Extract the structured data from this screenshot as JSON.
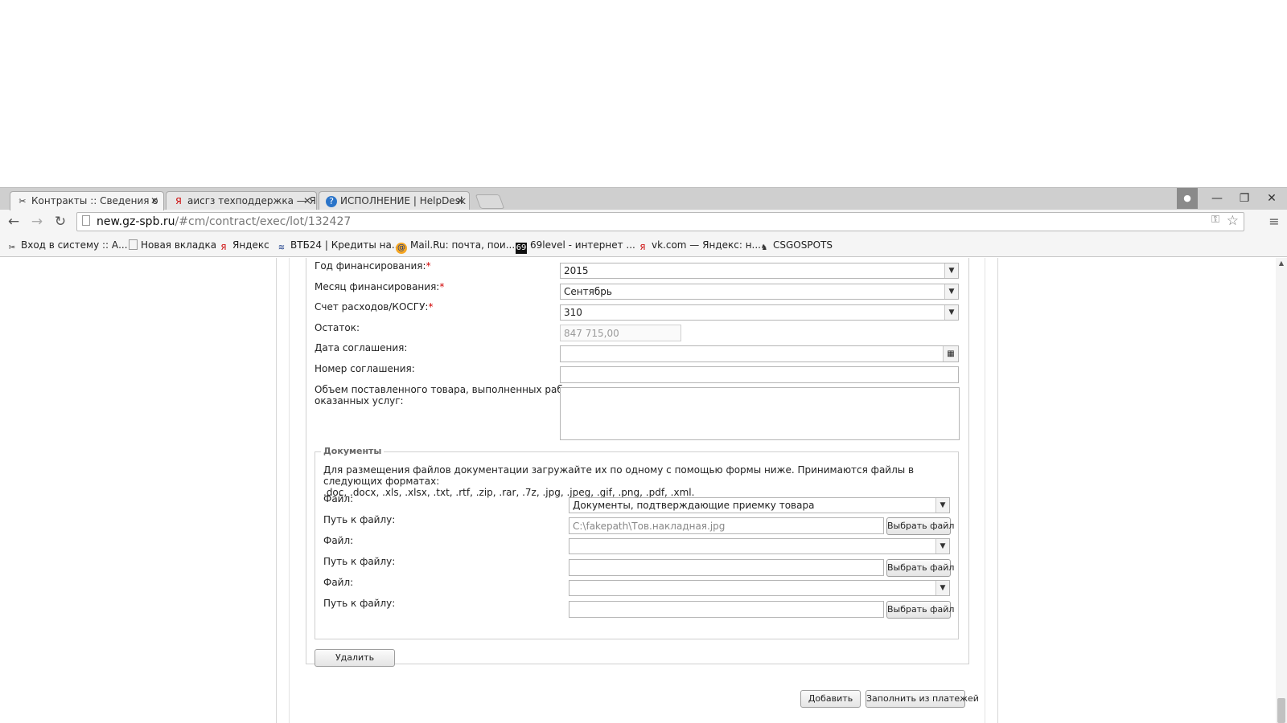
{
  "browser": {
    "tabs": [
      {
        "title": "Контракты :: Сведения о",
        "icon": "contract-icon",
        "close": "✕"
      },
      {
        "title": "аисгз техподдержка — Я",
        "icon": "yandex-icon",
        "close": "✕"
      },
      {
        "title": "ИСПОЛНЕНИЕ | HelpDesk",
        "icon": "helpdesk-icon",
        "close": "✕"
      }
    ],
    "window_controls": {
      "minimize": "—",
      "restore": "❐",
      "close": "✕"
    },
    "url_host": "new.gz-spb.ru",
    "url_path": "/#cm/contract/exec/lot/132427",
    "bookmarks": [
      {
        "label": "Вход в систему :: А...",
        "icon": "contract-icon"
      },
      {
        "label": "Новая вкладка",
        "icon": "page-icon"
      },
      {
        "label": "Яндекс",
        "icon": "yandex-icon"
      },
      {
        "label": "ВТБ24 | Кредиты на...",
        "icon": "vtb-icon"
      },
      {
        "label": "Mail.Ru: почта, пои...",
        "icon": "mailru-icon"
      },
      {
        "label": "69level - интернет ...",
        "icon": "69level-icon"
      },
      {
        "label": "vk.com — Яндекс: н...",
        "icon": "yandex-icon"
      },
      {
        "label": "CSGOSPOTS",
        "icon": "csgo-icon"
      }
    ]
  },
  "form": {
    "year_label": "Год финансирования:",
    "year_value": "2015",
    "month_label": "Месяц финансирования:",
    "month_value": "Сентябрь",
    "account_label": "Счет расходов/КОСГУ:",
    "account_value": "310",
    "balance_label": "Остаток:",
    "balance_value": "847 715,00",
    "agreement_date_label": "Дата соглашения:",
    "agreement_date_value": "",
    "agreement_number_label": "Номер соглашения:",
    "agreement_number_value": "",
    "volume_label_line1": "Объем поставленного товара, выполненных работ,",
    "volume_label_line2": "оказанных услуг:",
    "required_mark": "*"
  },
  "documents": {
    "legend": "Документы",
    "info_line1": "Для размещения файлов документации загружайте их по одному с помощью формы ниже. Принимаются файлы в следующих форматах:",
    "info_line2": ".doc, .docx, .xls, .xlsx, .txt, .rtf, .zip, .rar, .7z, .jpg, .jpeg, .gif, .png, .pdf, .xml.",
    "file_label": "Файл:",
    "path_label": "Путь к файлу:",
    "choose_button": "Выбрать файл",
    "rows": [
      {
        "file_value": "Документы, подтверждающие приемку товара",
        "path_value": "C:\\fakepath\\Тов.накладная.jpg"
      },
      {
        "file_value": "",
        "path_value": ""
      },
      {
        "file_value": "",
        "path_value": ""
      }
    ]
  },
  "buttons": {
    "delete": "Удалить",
    "add": "Добавить",
    "fill_from_payments": "Заполнить из платежей"
  }
}
